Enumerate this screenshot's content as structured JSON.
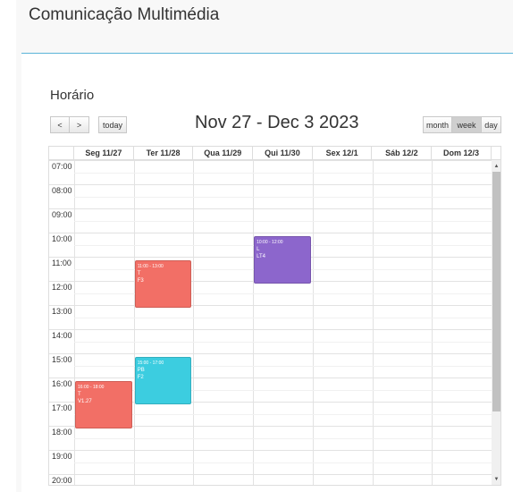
{
  "header": {
    "title": "Comunicação Multimédia"
  },
  "section": {
    "title": "Horário"
  },
  "toolbar": {
    "prev_label": "<",
    "next_label": ">",
    "today_label": "today",
    "range_title": "Nov 27 - Dec 3 2023",
    "views": [
      {
        "label": "month",
        "active": false
      },
      {
        "label": "week",
        "active": true
      },
      {
        "label": "day",
        "active": false
      }
    ]
  },
  "calendar": {
    "days": [
      "Seg 11/27",
      "Ter 11/28",
      "Qua 11/29",
      "Qui 11/30",
      "Sex 12/1",
      "Sáb 12/2",
      "Dom 12/3"
    ],
    "hours": [
      "07:00",
      "08:00",
      "09:00",
      "10:00",
      "11:00",
      "12:00",
      "13:00",
      "14:00",
      "15:00",
      "16:00",
      "17:00",
      "18:00",
      "19:00",
      "20:00"
    ],
    "events": [
      {
        "day": 3,
        "start": 10,
        "end": 12,
        "time": "10:00 - 12:00",
        "type": "L",
        "room": "LT4",
        "color": "#8c66cc"
      },
      {
        "day": 1,
        "start": 11,
        "end": 13,
        "time": "11:00 - 13:00",
        "type": "T",
        "room": "F3",
        "color": "#f26f66"
      },
      {
        "day": 1,
        "start": 15,
        "end": 17,
        "time": "15:00 - 17:00",
        "type": "PB",
        "room": "F2",
        "color": "#3ccde0"
      },
      {
        "day": 0,
        "start": 16,
        "end": 18,
        "time": "16:00 - 18:00",
        "type": "T",
        "room": "V1.27",
        "color": "#f26f66"
      }
    ]
  }
}
